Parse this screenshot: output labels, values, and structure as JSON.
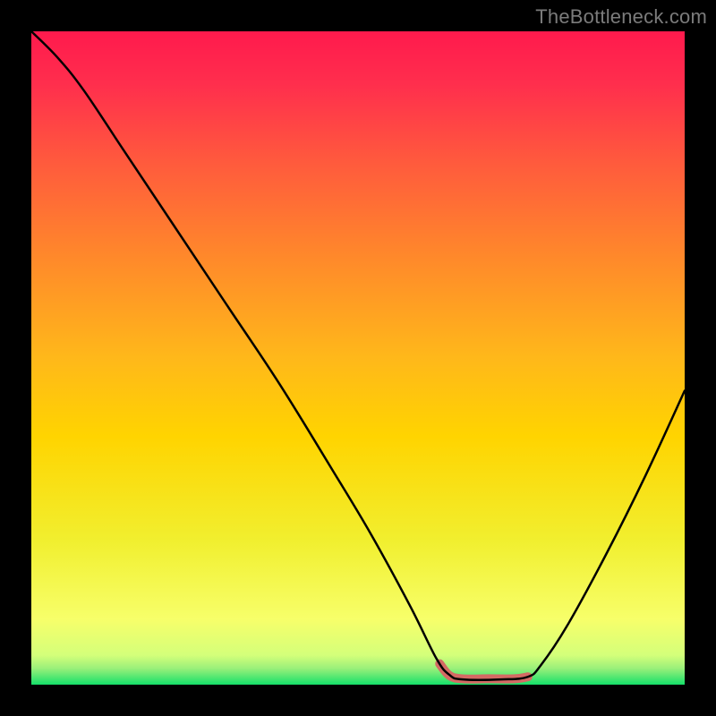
{
  "attribution": "TheBottleneck.com",
  "chart_data": {
    "type": "line",
    "title": "",
    "xlabel": "",
    "ylabel": "",
    "xlim": [
      0,
      100
    ],
    "ylim": [
      0,
      100
    ],
    "grid": false,
    "legend": false,
    "background_gradient": {
      "top_color": "#ff1a4d",
      "mid_color": "#ffd400",
      "near_bottom_color": "#f7ff6a",
      "bottom_color": "#15e06a"
    },
    "curve": {
      "stroke": "#000000",
      "stroke_width": 2.5,
      "points": [
        {
          "x": 0,
          "y": 100
        },
        {
          "x": 4,
          "y": 96
        },
        {
          "x": 8,
          "y": 91
        },
        {
          "x": 14,
          "y": 82
        },
        {
          "x": 22,
          "y": 70
        },
        {
          "x": 30,
          "y": 58
        },
        {
          "x": 38,
          "y": 46
        },
        {
          "x": 46,
          "y": 33
        },
        {
          "x": 52,
          "y": 23
        },
        {
          "x": 58,
          "y": 12
        },
        {
          "x": 62,
          "y": 4
        },
        {
          "x": 64,
          "y": 1.5
        },
        {
          "x": 66,
          "y": 0.8
        },
        {
          "x": 72,
          "y": 0.8
        },
        {
          "x": 76,
          "y": 1.2
        },
        {
          "x": 78,
          "y": 3
        },
        {
          "x": 82,
          "y": 9
        },
        {
          "x": 88,
          "y": 20
        },
        {
          "x": 94,
          "y": 32
        },
        {
          "x": 100,
          "y": 45
        }
      ]
    },
    "bottom_accent": {
      "stroke": "#d46a64",
      "stroke_width": 10,
      "points": [
        {
          "x": 62.5,
          "y": 3.2
        },
        {
          "x": 64,
          "y": 1.4
        },
        {
          "x": 66,
          "y": 0.9
        },
        {
          "x": 70,
          "y": 0.9
        },
        {
          "x": 74,
          "y": 0.9
        },
        {
          "x": 76,
          "y": 1.2
        }
      ]
    }
  }
}
